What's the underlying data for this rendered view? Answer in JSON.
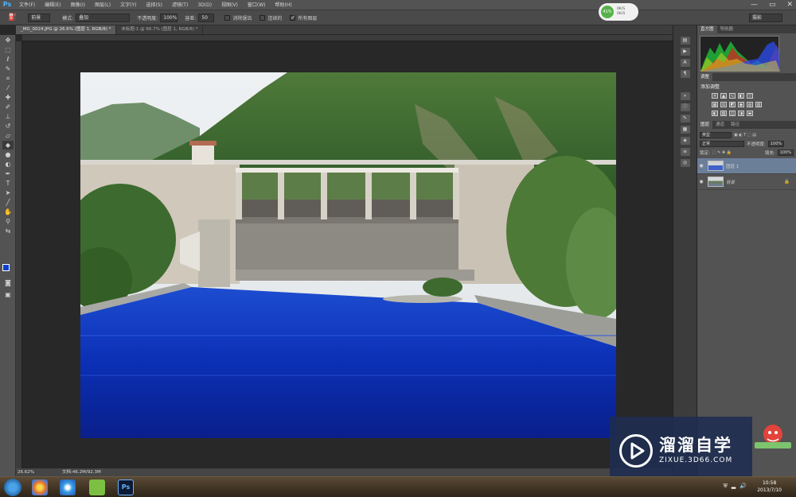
{
  "app": {
    "logo": "Ps"
  },
  "menubar": {
    "items": [
      "文件(F)",
      "编辑(E)",
      "图像(I)",
      "图层(L)",
      "文字(Y)",
      "选择(S)",
      "滤镜(T)",
      "3D(D)",
      "视图(V)",
      "窗口(W)",
      "帮助(H)"
    ],
    "window_controls": [
      "—",
      "▭",
      "✕"
    ]
  },
  "options": {
    "tool_preset": "前景",
    "mode_label": "模式:",
    "mode_value": "叠加",
    "opacity_label": "不透明度:",
    "opacity_value": "100%",
    "tolerance_label": "容差:",
    "tolerance_value": "50",
    "antialias_label": "消除锯齿",
    "contiguous_label": "连续的",
    "all_layers_label": "所有图层",
    "workspace": "摄影"
  },
  "perf_widget": {
    "percent": "41%",
    "stat1": "0K/S",
    "stat2": "0K/S"
  },
  "tabs": [
    {
      "label": "_MG_0024.JPG @ 26.6% (图层 1, RGB/8) *",
      "active": true
    },
    {
      "label": "未标题-1 @ 66.7% (图层 1, RGB/8) *",
      "active": false
    }
  ],
  "statusbar": {
    "zoom": "26.62%",
    "doc": "文档:46.2M/92.3M"
  },
  "panels": {
    "histogram_tabs": [
      "直方图",
      "导航器"
    ],
    "adjustments_tab": "调整",
    "adjustments_title": "添加调整",
    "layers_tabs": [
      "图层",
      "通道",
      "路径"
    ],
    "kind_label": "类型",
    "blend_mode": "正常",
    "opacity_label": "不透明度:",
    "opacity_value": "100%",
    "lock_label": "锁定:",
    "fill_label": "填充:",
    "fill_value": "100%",
    "layers": [
      {
        "name": "图层 1",
        "selected": true,
        "locked": false
      },
      {
        "name": "背景",
        "selected": false,
        "locked": true
      }
    ]
  },
  "taskbar": {
    "time": "10:58",
    "date": "2013/7/10"
  },
  "watermark": {
    "title": "溜溜自学",
    "url": "ZIXUE.3D66.COM"
  },
  "colors": {
    "foreground": "#0a3fd1",
    "accent_panel": "#535353"
  }
}
